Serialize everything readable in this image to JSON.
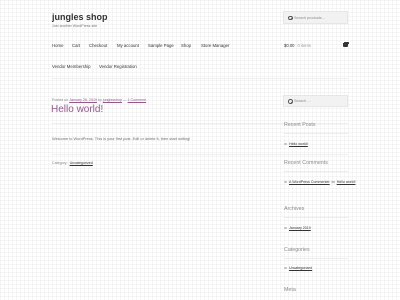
{
  "site": {
    "title": "jungles shop",
    "description": "Just another WordPress site"
  },
  "header_search": {
    "placeholder": "Search products…"
  },
  "nav": {
    "row1": [
      "Home",
      "Cart",
      "Checkout",
      "My account",
      "Sample Page",
      "Shop",
      "Store Manager"
    ],
    "row2": [
      "Vendor Membership",
      "Vendor Registration"
    ]
  },
  "cart": {
    "amount": "$0.00",
    "items": "0 items"
  },
  "post": {
    "meta_posted_on": "Posted on",
    "meta_date": "January 26, 2019",
    "meta_by": "by",
    "meta_author": "junglesshop",
    "meta_sep": "—",
    "meta_comments": "1 Comment",
    "title": "Hello world!",
    "body": "Welcome to WordPress. This is your first post. Edit or delete it, then start writing!",
    "category_label": "Category:",
    "category": "Uncategorized"
  },
  "sidebar": {
    "search_placeholder": "Search …",
    "recent_posts_title": "Recent Posts",
    "recent_posts": [
      "Hello world!"
    ],
    "recent_comments_title": "Recent Comments",
    "comment_author": "A WordPress Commenter",
    "comment_on": "on",
    "comment_post": "Hello world!",
    "archives_title": "Archives",
    "archives": [
      "January 2019"
    ],
    "categories_title": "Categories",
    "categories": [
      "Uncategorized"
    ],
    "meta_title": "Meta"
  },
  "colors": {
    "accent": "#96588a",
    "text": "#6d6d6d",
    "heading": "#333333"
  }
}
